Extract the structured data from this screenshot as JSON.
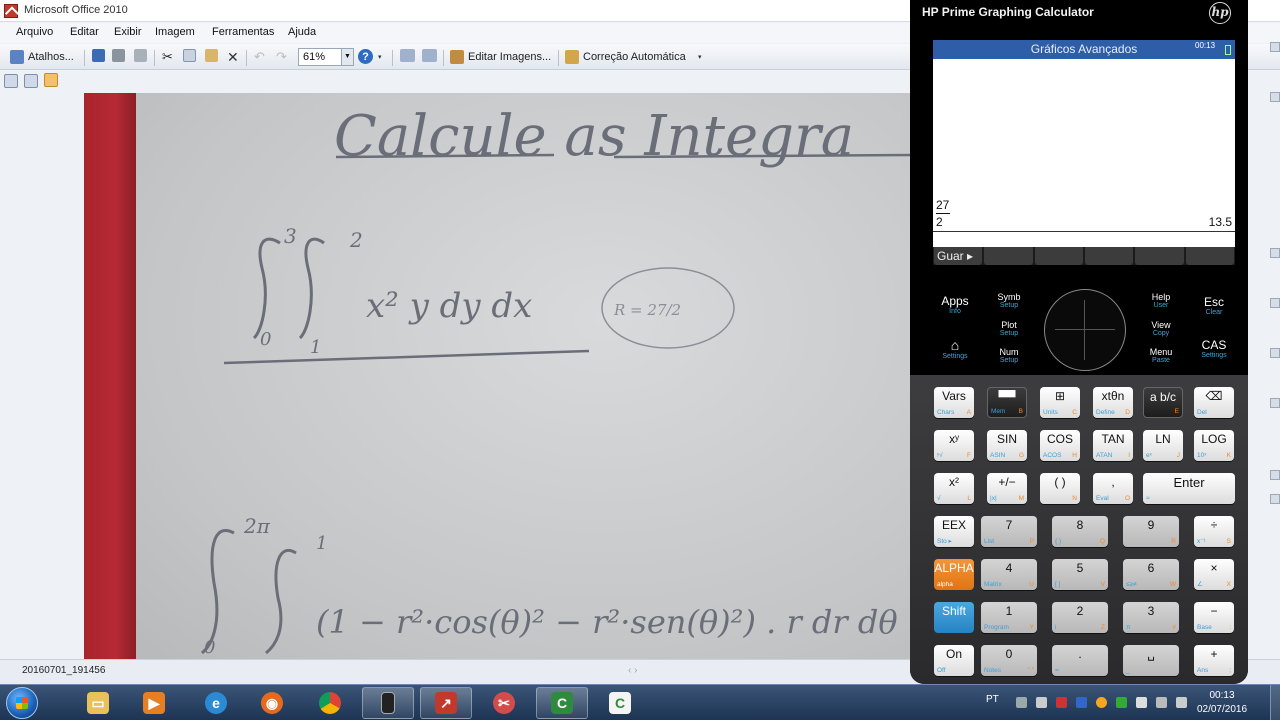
{
  "office": {
    "window_title": "Microsoft Office 2010",
    "menu": [
      "Arquivo",
      "Editar",
      "Exibir",
      "Imagem",
      "Ferramentas",
      "Ajuda"
    ],
    "toolbar": {
      "shortcuts_label": "Atalhos...",
      "zoom_value": "61%",
      "edit_images_label": "Editar Imagens...",
      "autocorrect_label": "Correção Automática"
    },
    "status_filename": "20160701_191456"
  },
  "photo": {
    "heading": "Calcule as Integra",
    "integral1": {
      "upper_outer": "3",
      "upper_inner": "2",
      "lower_outer": "0",
      "lower_inner": "1",
      "integrand": "x² y dy dx",
      "answer": "R = 27/2"
    },
    "integral2": {
      "upper_outer": "2π",
      "upper_inner": "1",
      "lower_outer": "0",
      "integrand": "(1 − r²·cos(θ)² − r²·sen(θ)²) . r dr dθ"
    }
  },
  "calculator": {
    "title": "HP Prime Graphing Calculator",
    "logo": "hp",
    "screen": {
      "header_title": "Gráficos Avançados",
      "time": "00:13",
      "fraction_numerator": "27",
      "fraction_denominator": "2",
      "result": "13.5",
      "softkeys": [
        "Guar ▸",
        "",
        "",
        "",
        "",
        ""
      ]
    },
    "top_keys": {
      "apps": {
        "main": "Apps",
        "sub": "Info"
      },
      "symb": {
        "main": "Symb",
        "sub": "Setup"
      },
      "help": {
        "main": "Help",
        "sub": "User"
      },
      "esc": {
        "main": "Esc",
        "sub": "Clear"
      },
      "plot": {
        "main": "Plot",
        "sub": "Setup"
      },
      "view": {
        "main": "View",
        "sub": "Copy"
      },
      "home": {
        "main": "⌂",
        "sub": "Settings"
      },
      "num": {
        "main": "Num",
        "sub": "Setup"
      },
      "menu": {
        "main": "Menu",
        "sub": "Paste"
      },
      "cas": {
        "main": "CAS",
        "sub": "Settings"
      }
    },
    "keys": [
      {
        "main": "Vars",
        "blue": "Chars",
        "orange": "A"
      },
      {
        "main": "▀▀",
        "blue": "Mem",
        "orange": "B"
      },
      {
        "main": "⊞",
        "blue": "Units",
        "orange": "C"
      },
      {
        "main": "xtθn",
        "blue": "Define",
        "orange": "D"
      },
      {
        "main": "a b/c",
        "blue": "",
        "orange": "E"
      },
      {
        "main": "⌫",
        "blue": "Del",
        "orange": ""
      },
      {
        "main": "xʸ",
        "blue": "ʸ√",
        "orange": "F"
      },
      {
        "main": "SIN",
        "blue": "ASIN",
        "orange": "G"
      },
      {
        "main": "COS",
        "blue": "ACOS",
        "orange": "H"
      },
      {
        "main": "TAN",
        "blue": "ATAN",
        "orange": "I"
      },
      {
        "main": "LN",
        "blue": "eˣ",
        "orange": "J"
      },
      {
        "main": "LOG",
        "blue": "10ˣ",
        "orange": "K"
      },
      {
        "main": "x²",
        "blue": "√",
        "orange": "L"
      },
      {
        "main": "+/−",
        "blue": "|x|",
        "orange": "M"
      },
      {
        "main": "( )",
        "blue": "",
        "orange": "N"
      },
      {
        "main": ",",
        "blue": "Eval",
        "orange": "O"
      },
      {
        "main": "Enter",
        "blue": "≈",
        "orange": ""
      },
      {
        "main": "EEX",
        "blue": "Sto ▸",
        "orange": ""
      },
      {
        "main": "7",
        "blue": "List",
        "orange": "P"
      },
      {
        "main": "8",
        "blue": "{ }",
        "orange": "Q"
      },
      {
        "main": "9",
        "blue": "",
        "orange": "R"
      },
      {
        "main": "÷",
        "blue": "x⁻¹",
        "orange": "S"
      },
      {
        "main": "ALPHA",
        "blue": "alpha",
        "orange": ""
      },
      {
        "main": "4",
        "blue": "Matrix",
        "orange": "U"
      },
      {
        "main": "5",
        "blue": "[ ]",
        "orange": "V"
      },
      {
        "main": "6",
        "blue": "≤≥≠",
        "orange": "W"
      },
      {
        "main": "×",
        "blue": "∠",
        "orange": "X"
      },
      {
        "main": "Shift",
        "blue": "",
        "orange": ""
      },
      {
        "main": "1",
        "blue": "Program",
        "orange": "Y"
      },
      {
        "main": "2",
        "blue": "i",
        "orange": "Z"
      },
      {
        "main": "3",
        "blue": "π",
        "orange": "#"
      },
      {
        "main": "−",
        "blue": "Base",
        "orange": ":"
      },
      {
        "main": "On",
        "blue": "Off",
        "orange": ""
      },
      {
        "main": "0",
        "blue": "Notes",
        "orange": "\" \""
      },
      {
        "main": ".",
        "blue": "=",
        "orange": ""
      },
      {
        "main": "␣",
        "blue": "_",
        "orange": ""
      },
      {
        "main": "+",
        "blue": "Ans",
        "orange": ";"
      }
    ]
  },
  "taskbar": {
    "language": "PT",
    "time": "00:13",
    "date": "02/07/2016"
  },
  "colors": {
    "screen_header": "#2e5ea8",
    "alpha_key": "#e07414",
    "shift_key": "#2683c2",
    "binder_red": "#b72a35"
  }
}
